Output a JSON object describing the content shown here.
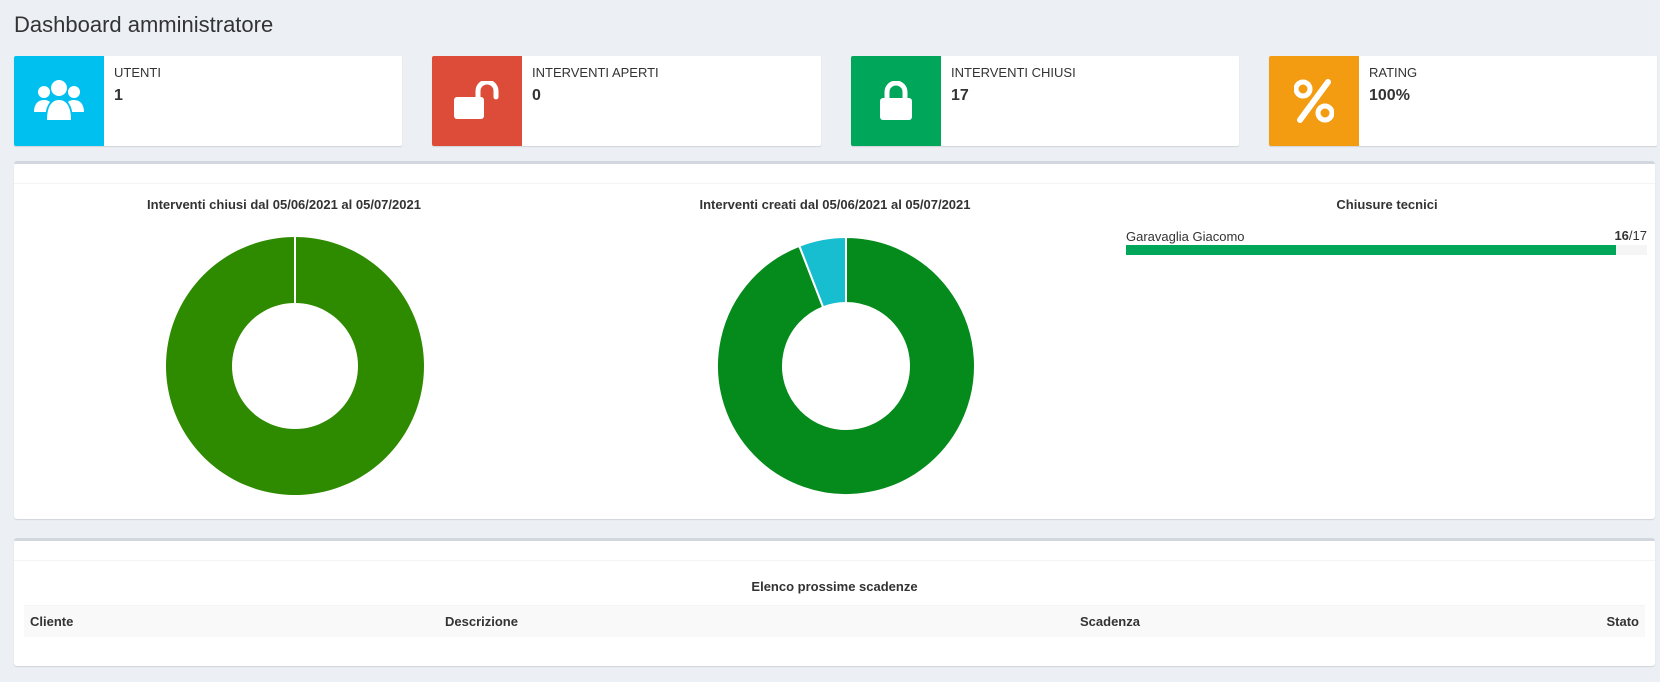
{
  "page": {
    "title": "Dashboard amministratore"
  },
  "info_boxes": [
    {
      "label": "UTENTI",
      "value": "1",
      "color": "#00c0ef",
      "icon": "users-icon"
    },
    {
      "label": "INTERVENTI APERTI",
      "value": "0",
      "color": "#dd4b39",
      "icon": "unlock-icon"
    },
    {
      "label": "INTERVENTI CHIUSI",
      "value": "17",
      "color": "#00a65a",
      "icon": "lock-icon"
    },
    {
      "label": "RATING",
      "value": "100%",
      "color": "#f39c12",
      "icon": "percent-icon"
    }
  ],
  "chart_data": [
    {
      "type": "pie",
      "title": "Interventi chiusi dal 05/06/2021 al 05/07/2021",
      "slices": [
        {
          "value": 1,
          "color": "#2e8b00"
        }
      ]
    },
    {
      "type": "pie",
      "title": "Interventi creati dal 05/06/2021 al 05/07/2021",
      "slices": [
        {
          "value": 94.1,
          "color": "#058b1c"
        },
        {
          "value": 5.9,
          "color": "#17becf"
        }
      ]
    }
  ],
  "technicians": {
    "title": "Chiusure tecnici",
    "items": [
      {
        "name": "Garavaglia Giacomo",
        "closed": "16",
        "total": "/17",
        "fraction": 0.9412,
        "color": "#00a65a"
      }
    ]
  },
  "deadlines": {
    "title": "Elenco prossime scadenze",
    "columns": [
      "Cliente",
      "Descrizione",
      "Scadenza",
      "Stato"
    ]
  }
}
